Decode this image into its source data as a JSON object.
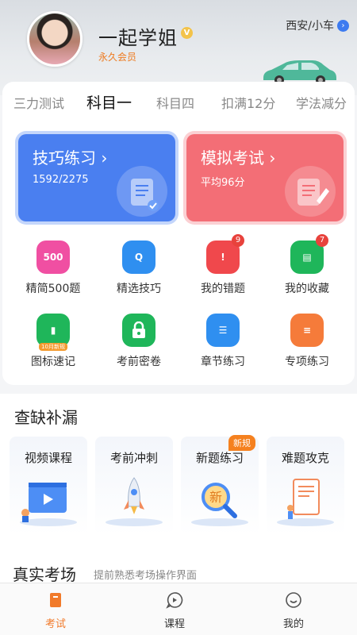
{
  "header": {
    "username": "一起学姐",
    "vip_label": "V",
    "member_label": "永久会员",
    "location": "西安/小车",
    "location_arrow": "›"
  },
  "tabs": [
    {
      "label": "三力测试"
    },
    {
      "label": "科目一"
    },
    {
      "label": "科目四"
    },
    {
      "label": "扣满12分"
    },
    {
      "label": "学法减分"
    }
  ],
  "big_cards": {
    "practice": {
      "title": "技巧练习 ›",
      "sub": "1592/2275"
    },
    "exam": {
      "title": "模拟考试 ›",
      "sub": "平均96分"
    }
  },
  "grid": [
    {
      "label": "精简500题",
      "icon_text": "500",
      "color": "#f04fa2"
    },
    {
      "label": "精选技巧",
      "icon_text": "Q",
      "color": "#2f8ff0"
    },
    {
      "label": "我的错题",
      "icon_text": "!",
      "color": "#f0484c",
      "badge": "9"
    },
    {
      "label": "我的收藏",
      "icon_text": "▤",
      "color": "#1fb65a",
      "badge": "7"
    },
    {
      "label": "图标速记",
      "icon_text": "▮",
      "color": "#1fb65a",
      "tag": "10月新规"
    },
    {
      "label": "考前密卷",
      "icon_text": "🔒",
      "color": "#1fb65a"
    },
    {
      "label": "章节练习",
      "icon_text": "☰",
      "color": "#2f8ff0"
    },
    {
      "label": "专项练习",
      "icon_text": "≡",
      "color": "#f57b3a"
    }
  ],
  "review": {
    "title": "查缺补漏",
    "cards": [
      {
        "label": "视频课程"
      },
      {
        "label": "考前冲刺"
      },
      {
        "label": "新题练习",
        "tag": "新规"
      },
      {
        "label": "难题攻克"
      }
    ],
    "new_glyph": "新"
  },
  "real_exam": {
    "title": "真实考场",
    "subtitle": "提前熟悉考场操作界面"
  },
  "tabbar": [
    {
      "label": "考试"
    },
    {
      "label": "课程"
    },
    {
      "label": "我的"
    }
  ],
  "colors": {
    "accent": "#f17a2a",
    "blue": "#4a7ff0",
    "red": "#f36e76"
  }
}
